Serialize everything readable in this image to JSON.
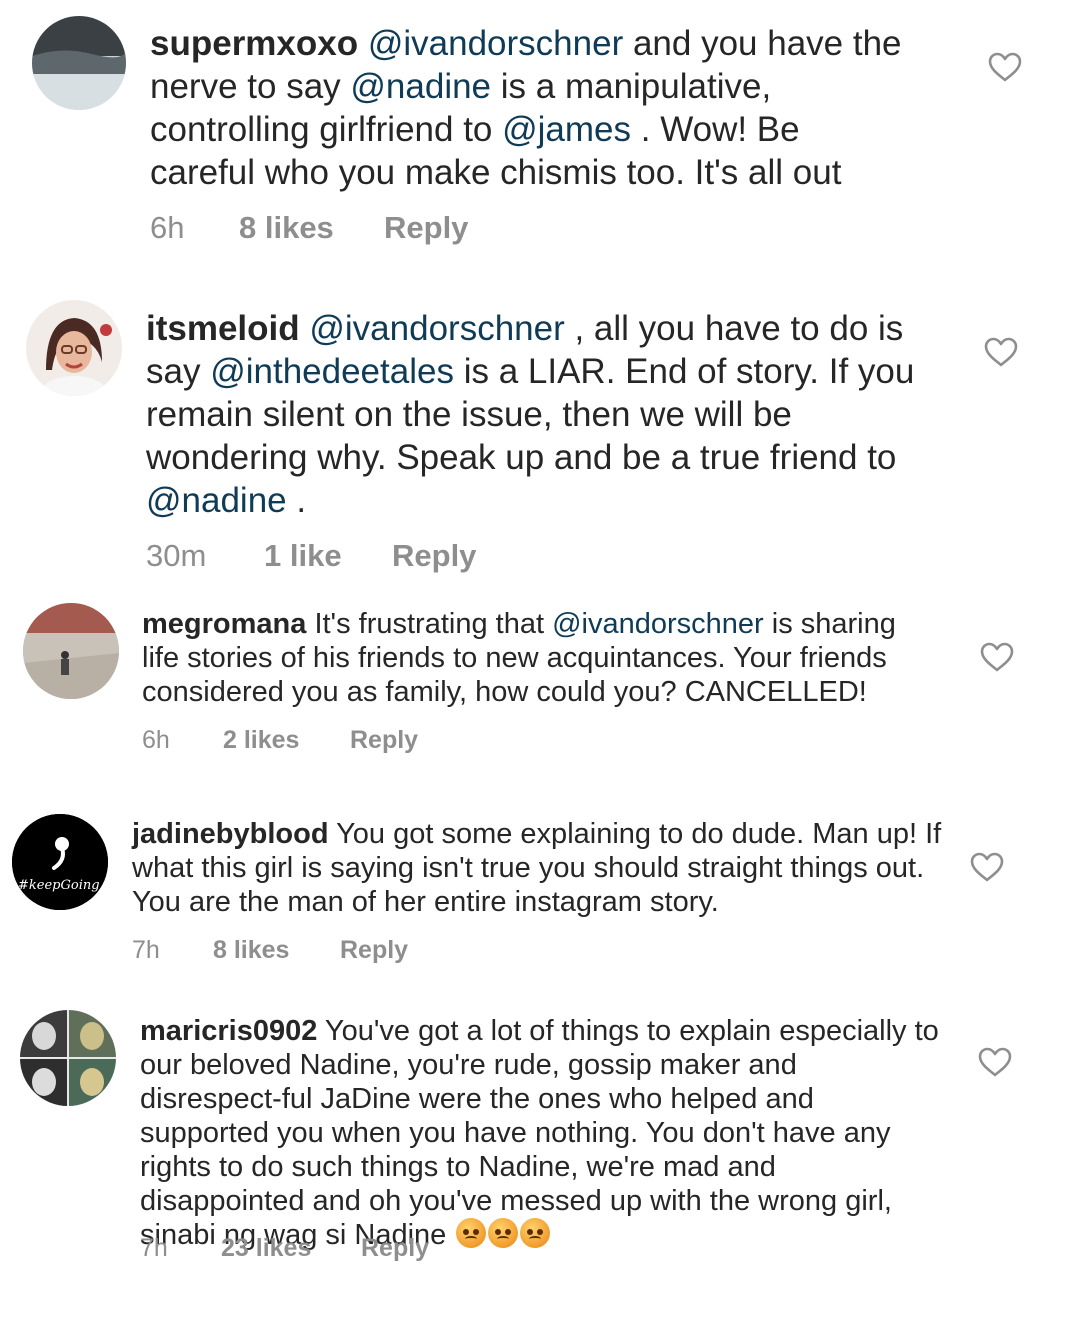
{
  "comments": [
    {
      "username": "supermxoxo",
      "parts": [
        {
          "m": "@ivandorschner"
        },
        {
          "t": " and you have the nerve to say "
        },
        {
          "m": "@nadine"
        },
        {
          "t": " is a manipulative, controlling girlfriend to "
        },
        {
          "m": "@james"
        },
        {
          "t": " . Wow! Be careful who you make chismis too. It's all out"
        }
      ],
      "time": "6h",
      "likes": "8 likes",
      "reply": "Reply",
      "avatar_icon": "avatar-photo-lake"
    },
    {
      "username": "itsmeloid",
      "parts": [
        {
          "m": "@ivandorschner"
        },
        {
          "t": " , all you have to do is say "
        },
        {
          "m": "@inthedeetales"
        },
        {
          "t": " is a LIAR. End of story.  If you remain silent on the issue, then we will be wondering why. Speak up and be a true friend to "
        },
        {
          "m": "@nadine"
        },
        {
          "t": " ."
        }
      ],
      "time": "30m",
      "likes": "1 like",
      "reply": "Reply",
      "avatar_icon": "avatar-photo-woman"
    },
    {
      "username": "megromana",
      "parts": [
        {
          "t": " It's frustrating that "
        },
        {
          "m": "@ivandorschner"
        },
        {
          "t": " is sharing life stories  of his friends to new acquintances. Your friends considered you as family, how could you? CANCELLED!"
        }
      ],
      "time": "6h",
      "likes": "2 likes",
      "reply": "Reply",
      "avatar_icon": "avatar-photo-plaza"
    },
    {
      "username": "jadinebyblood",
      "parts": [
        {
          "t": " You got some explaining to do dude. Man up! If what this girl is saying isn't true you should straight things out. You are the man of her entire instagram story."
        }
      ],
      "time": "7h",
      "likes": "8 likes",
      "reply": "Reply",
      "avatar_icon": "avatar-keepgoing-logo",
      "avatar_text": "#keepGoing"
    },
    {
      "username": "maricris0902",
      "parts": [
        {
          "t": " You've got a lot of things to explain especially to our beloved Nadine, you're rude, gossip maker and disrespect-ful JaDine were the ones who helped and supported you when you have nothing. You don't have any rights to do such things to Nadine, we're mad and disappointed and oh you've messed up with the wrong girl, sinabi ng wag si Nadine "
        }
      ],
      "emojis": [
        "angry-face-emoji",
        "angry-face-emoji",
        "angry-face-emoji"
      ],
      "time": "7h",
      "likes": "23 likes",
      "reply": "Reply",
      "avatar_icon": "avatar-photo-collage"
    }
  ],
  "icons": {
    "like": "heart-outline-icon"
  },
  "colors": {
    "text": "#262626",
    "mention": "#0f3b57",
    "meta": "#8e8e8e"
  }
}
